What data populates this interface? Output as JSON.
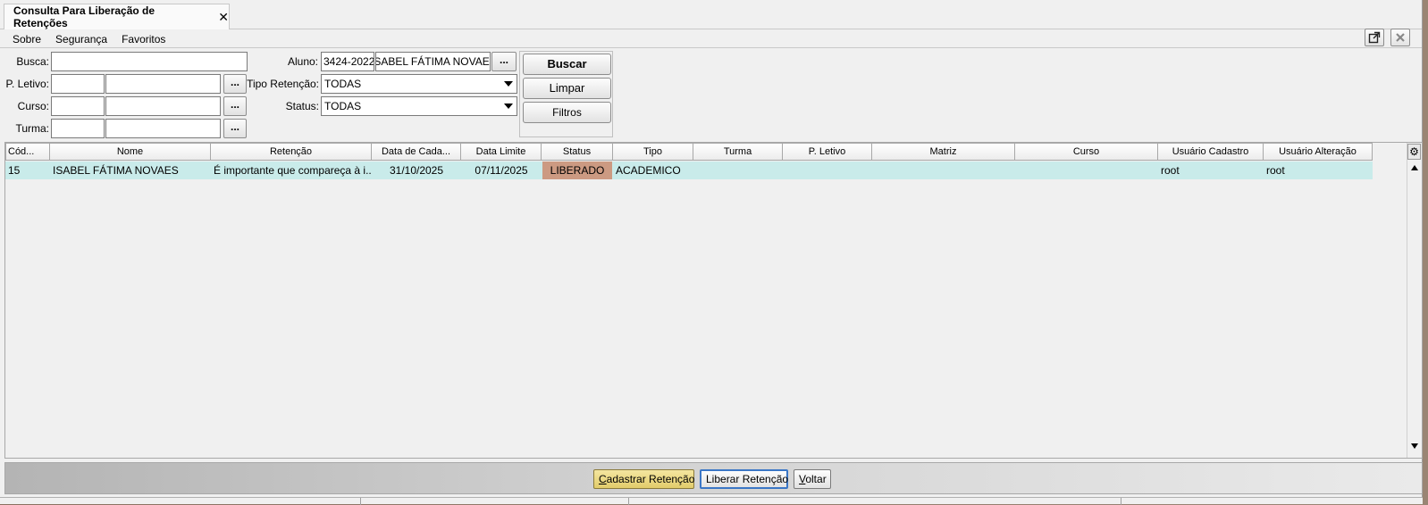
{
  "tab": {
    "title": "Consulta Para Liberação de Retenções",
    "close_glyph": "✕"
  },
  "menu": {
    "items": [
      "Sobre",
      "Segurança",
      "Favoritos"
    ]
  },
  "window_buttons": {
    "detach_icon": "external-link-icon",
    "close_icon": "close-icon"
  },
  "form": {
    "busca_label": "Busca:",
    "busca_value": "",
    "pletivo_label": "P. Letivo:",
    "curso_label": "Curso:",
    "turma_label": "Turma:",
    "aluno_label": "Aluno:",
    "aluno_code": "3424-2022",
    "aluno_name": "ISABEL FÁTIMA NOVAES",
    "tipo_label": "Tipo Retenção:",
    "tipo_value": "TODAS",
    "status_label": "Status:",
    "status_value": "TODAS",
    "lookup_label": "..."
  },
  "actions": {
    "buscar": "Buscar",
    "limpar": "Limpar",
    "filtros": "Filtros"
  },
  "grid": {
    "columns": [
      "Cód...",
      "Nome",
      "Retenção",
      "Data de Cada...",
      "Data Limite",
      "Status",
      "Tipo",
      "Turma",
      "P. Letivo",
      "Matriz",
      "Curso",
      "Usuário Cadastro",
      "Usuário Alteração"
    ],
    "rows": [
      {
        "cod": "15",
        "nome": "ISABEL FÁTIMA NOVAES",
        "retencao": "É importante que compareça à i...",
        "data_cadastro": "31/10/2025",
        "data_limite": "07/11/2025",
        "status": "LIBERADO",
        "tipo": "ACADEMICO",
        "turma": "",
        "pletivo": "",
        "matriz": "",
        "curso": "",
        "usuario_cadastro": "root",
        "usuario_alteracao": "root"
      }
    ],
    "status_color": "#cc9a82",
    "row_color": "#c9ebea"
  },
  "bottom": {
    "cadastrar": {
      "underline": "C",
      "rest": "adastrar Retenção"
    },
    "liberar": "Liberar Retenção",
    "voltar": {
      "underline": "V",
      "rest": "oltar"
    }
  }
}
